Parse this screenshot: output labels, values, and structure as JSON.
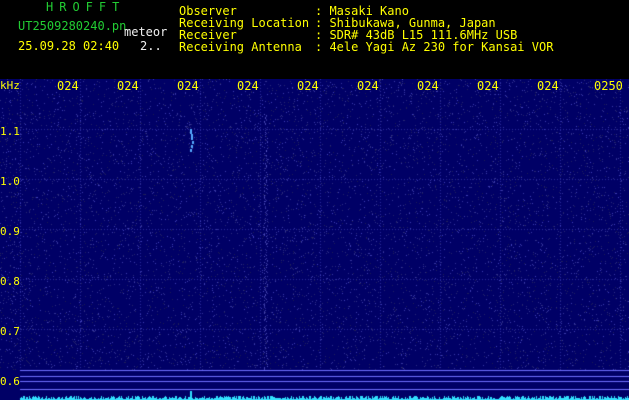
{
  "header": {
    "brand": "HROFFT",
    "filename": "UT2509280240.pn",
    "mode_label": "meteor",
    "datetime": "25.09.28 02:40",
    "count": "2..",
    "meta": [
      {
        "key": "Observer",
        "value": ": Masaki Kano"
      },
      {
        "key": "Receiving Location",
        "value": ": Shibukawa, Gunma, Japan"
      },
      {
        "key": "Receiver",
        "value": ": SDR# 43dB L15 111.6MHz USB"
      },
      {
        "key": "Receiving Antenna",
        "value": ": 4ele Yagi Az 230 for Kansai VOR"
      }
    ]
  },
  "spectrogram": {
    "y_unit": "kHz",
    "y_ticks": [
      "1.1",
      "1.0",
      "0.9",
      "0.8",
      "0.7",
      "0.6"
    ],
    "x_ticks": [
      "024",
      "024",
      "024",
      "024",
      "024",
      "024",
      "024",
      "024",
      "024",
      "0250"
    ],
    "colors": {
      "background": "#000066",
      "grid": "#2a2aa0",
      "noise": "#4a4ad0",
      "line": "#6f6fff",
      "echo": "#55aaff",
      "trace": "#33e0ff"
    }
  }
}
